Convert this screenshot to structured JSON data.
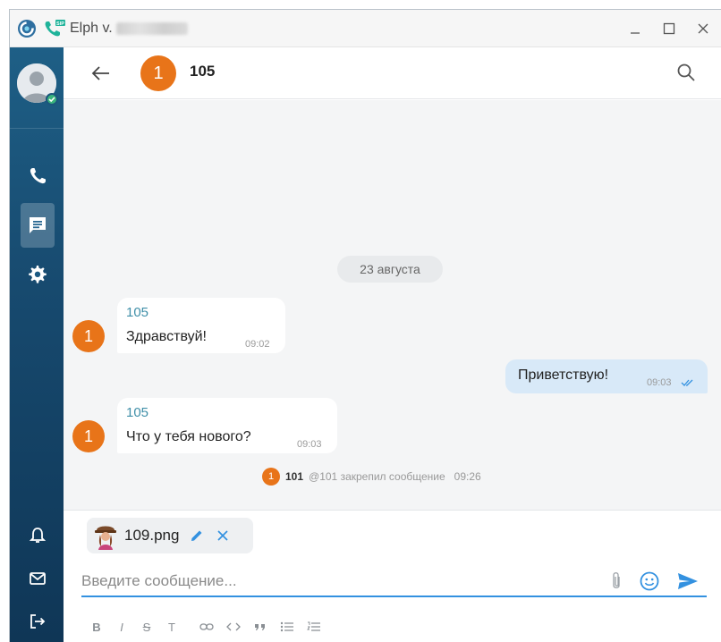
{
  "titlebar": {
    "app_title": "Elph v.",
    "minimize": "_",
    "maximize": "☐",
    "close": "✕"
  },
  "chat_header": {
    "avatar_initial": "1",
    "title": "105"
  },
  "messages": {
    "date_divider": "23 августа",
    "items": [
      {
        "direction": "in",
        "avatar_initial": "1",
        "sender": "105",
        "text": "Здравствуй!",
        "time": "09:02"
      },
      {
        "direction": "out",
        "text": "Приветствую!",
        "time": "09:03",
        "status": "read"
      },
      {
        "direction": "in",
        "avatar_initial": "1",
        "sender": "105",
        "text": "Что у тебя нового?",
        "time": "09:03"
      }
    ],
    "system": {
      "avatar_initial": "1",
      "user": "101",
      "text": "@101 закрепил сообщение",
      "time": "09:26"
    }
  },
  "composer": {
    "attachment_name": "109.png",
    "placeholder": "Введите сообщение...",
    "format_buttons": [
      "B",
      "I",
      "S",
      "T",
      "link",
      "code",
      "quote",
      "bullet-list",
      "numbered-list"
    ]
  },
  "colors": {
    "sidebar": "#1b557c",
    "avatar_orange": "#e87419",
    "accent_blue": "#3391e0",
    "outgoing_bubble": "#d8e9f8"
  }
}
